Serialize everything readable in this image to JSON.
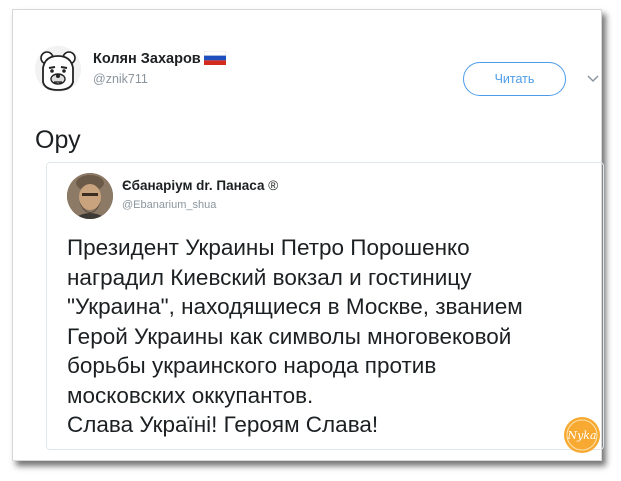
{
  "tweet": {
    "author": {
      "name": "Колян Захаров",
      "handle": "@znik711",
      "flag_icon": "russia-flag-icon",
      "avatar_icon": "bear-avatar-icon"
    },
    "follow_label": "Читать",
    "menu_icon": "chevron-down-icon",
    "text": "Ору",
    "accent_color": "#4c9ce9"
  },
  "quoted_tweet": {
    "author": {
      "name": "Єбанаріум dr. Панаса",
      "verified_mark": "®",
      "handle": "@Ebanarium_shua",
      "avatar_icon": "bearded-man-avatar-icon"
    },
    "lines": [
      "Президент Украины Петро Порошенко",
      "наградил Киевский вокзал и гостиницу",
      "\"Украина\", находящиеся в Москве, званием",
      "Герой Украины как символы многовековой",
      "борьбы украинского народа против",
      "московских оккупантов.",
      "Слава Україні! Героям Слава!"
    ]
  },
  "watermark": {
    "text": "Nyka",
    "icon": "site-logo-icon",
    "color": "#f7a01c"
  }
}
